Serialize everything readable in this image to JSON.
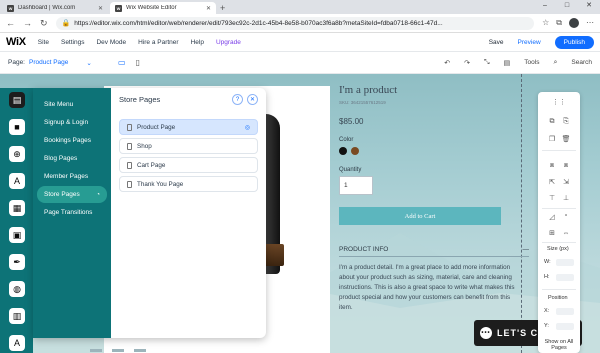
{
  "browser": {
    "tabs": [
      {
        "title": "Dashboard | Wix.com",
        "active": false
      },
      {
        "title": "Wix Website Editor",
        "active": true
      }
    ],
    "url": "https://editor.wix.com/html/editor/web/renderer/edit/793ec92c-2d1c-45b4-8e58-b070ac3f6a8b?metaSiteId=fdba0718-66c1-47d...",
    "window_controls": [
      "–",
      "□",
      "✕"
    ]
  },
  "wix_topbar": {
    "logo": "WiX",
    "menu": [
      "Site",
      "Settings",
      "Dev Mode",
      "Hire a Partner",
      "Help",
      "Upgrade"
    ],
    "save_label": "Save",
    "preview_label": "Preview",
    "publish_label": "Publish"
  },
  "wix_secondbar": {
    "page_prefix": "Page:",
    "page_name": "Product Page",
    "tools_label": "Tools",
    "search_label": "Search"
  },
  "pages_panel": {
    "menu_items": [
      {
        "label": "Site Menu"
      },
      {
        "label": "Signup & Login"
      },
      {
        "label": "Bookings Pages"
      },
      {
        "label": "Blog Pages"
      },
      {
        "label": "Member Pages"
      },
      {
        "label": "Store Pages",
        "selected": true
      },
      {
        "label": "Page Transitions"
      }
    ],
    "title": "Store Pages",
    "help_icon": "?",
    "close_icon": "✕",
    "pages": [
      {
        "label": "Product Page",
        "selected": true
      },
      {
        "label": "Shop"
      },
      {
        "label": "Cart Page"
      },
      {
        "label": "Thank You Page"
      }
    ]
  },
  "product": {
    "title": "I'm a product",
    "sku": "SKU: 36421557612519",
    "price": "$85.00",
    "color_label": "Color",
    "colors": [
      "#111111",
      "#7a4a22"
    ],
    "quantity_label": "Quantity",
    "quantity_value": "1",
    "add_to_cart": "Add to Cart",
    "info_label": "PRODUCT INFO",
    "info_toggle": "—",
    "description": "I'm a product detail. I'm a great place to add more information about your product such as sizing, material, care and cleaning instructions. This is also a great space to write what makes this product special and how your customers can benefit from this item."
  },
  "chat": {
    "label": "LET'S CHAT!"
  },
  "inspector": {
    "size_label": "Size (px)",
    "w_label": "W:",
    "h_label": "H:",
    "position_label": "Position",
    "x_label": "X:",
    "y_label": "Y:",
    "show_all": "Show on All Pages"
  },
  "colors": {
    "wix_blue": "#116dff",
    "panel_teal": "#0d7377",
    "add_to_cart": "#5cb6be",
    "upgrade_purple": "#7a3ee8"
  }
}
